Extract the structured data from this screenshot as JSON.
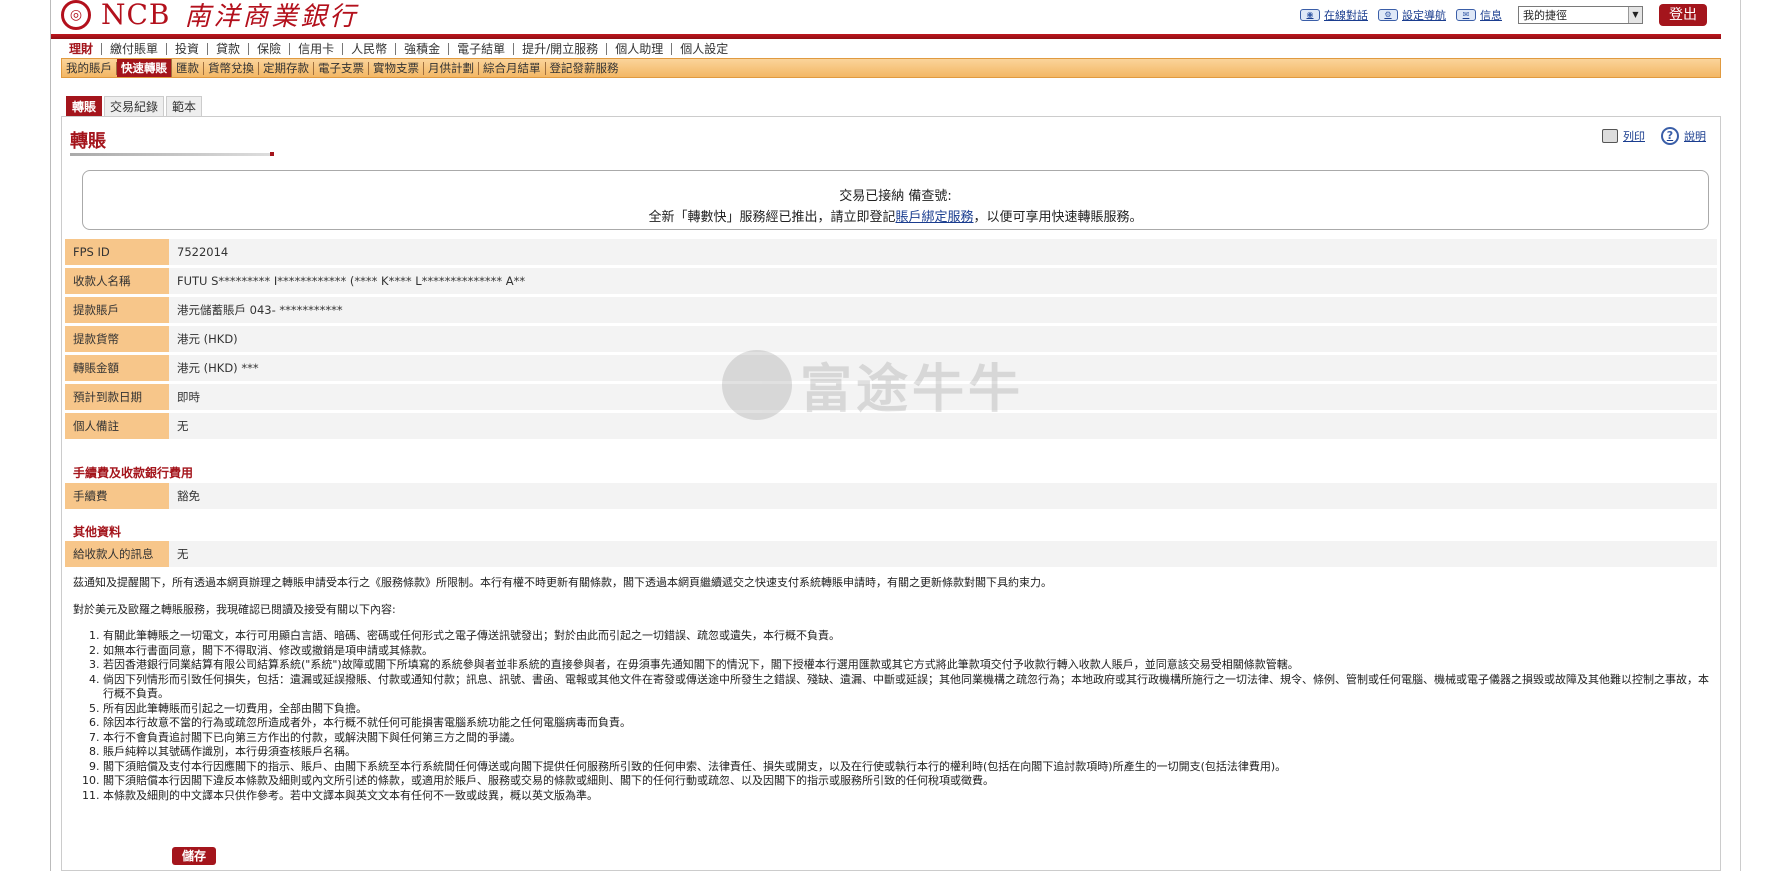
{
  "header": {
    "logo_mark": "NCB",
    "logo_text": "NCB",
    "logo_cn": "南洋商業銀行",
    "tools": [
      {
        "label": "在線對話",
        "icon": "chat-icon"
      },
      {
        "label": "設定導航",
        "icon": "settings-icon"
      },
      {
        "label": "信息",
        "icon": "mail-icon"
      }
    ],
    "quick_select": "我的捷徑",
    "logout_label": "登出"
  },
  "main_nav": [
    {
      "label": "理財",
      "active": true
    },
    {
      "label": "繳付賬單"
    },
    {
      "label": "投資"
    },
    {
      "label": "貸款"
    },
    {
      "label": "保險"
    },
    {
      "label": "信用卡"
    },
    {
      "label": "人民幣"
    },
    {
      "label": "強積金"
    },
    {
      "label": "電子結單"
    },
    {
      "label": "提升/開立服務"
    },
    {
      "label": "個人助理"
    },
    {
      "label": "個人設定"
    }
  ],
  "sub_nav": [
    {
      "label": "我的賬戶"
    },
    {
      "label": "快速轉賬",
      "active": true
    },
    {
      "label": "匯款"
    },
    {
      "label": "貨幣兌換"
    },
    {
      "label": "定期存款"
    },
    {
      "label": "電子支票"
    },
    {
      "label": "實物支票"
    },
    {
      "label": "月供計劃"
    },
    {
      "label": "綜合月結單"
    },
    {
      "label": "登記發薪服務"
    }
  ],
  "tabs": [
    {
      "label": "轉賬",
      "active": true
    },
    {
      "label": "交易紀錄"
    },
    {
      "label": "範本"
    }
  ],
  "page": {
    "title": "轉賬",
    "print_label": "列印",
    "help_label": "說明"
  },
  "notice": {
    "line1": "交易已接納 備查號:",
    "line2_prefix": "全新「轉數快」服務經已推出，請立即登記",
    "line2_link": "賬戶綁定服務",
    "line2_suffix": "，以便可享用快速轉賬服務。"
  },
  "details": [
    {
      "label": "FPS ID",
      "value": "7522014"
    },
    {
      "label": "收款人名稱",
      "value": "FUTU S********* I************ (**** K**** L************** A**"
    },
    {
      "label": "提款賬戶",
      "value": "港元儲蓄賬戶 043-  ***********"
    },
    {
      "label": "提款貨幣",
      "value": "港元 (HKD)"
    },
    {
      "label": "轉賬金額",
      "value": "港元 (HKD)  ***"
    },
    {
      "label": "預計到款日期",
      "value": "即時"
    },
    {
      "label": "個人備註",
      "value": "无"
    }
  ],
  "fees": {
    "section_title": "手續費及收款銀行費用",
    "label": "手續費",
    "value": "豁免"
  },
  "other": {
    "section_title": "其他資料",
    "label": "給收款人的訊息",
    "value": "无"
  },
  "terms": {
    "intro": "茲通知及提醒閣下，所有透過本網頁辦理之轉賬申請受本行之《服務條款》所限制。本行有權不時更新有關條款，閣下透過本網頁繼續遞交之快速支付系統轉賬申請時，有關之更新條款對閣下具約束力。",
    "intro2": "對於美元及歐羅之轉賬服務，我現確認已閱讀及接受有關以下內容:",
    "items": [
      "有關此筆轉賬之一切電文，本行可用顯白言語、暗碼、密碼或任何形式之電子傳送訊號發出；對於由此而引起之一切錯誤、疏忽或遺失，本行概不負責。",
      "如無本行書面同意，閣下不得取消、修改或撤銷是項申請或其條款。",
      "若因香港銀行同業結算有限公司結算系統(\"系統\")故障或閣下所填寫的系統參與者並非系統的直接參與者，在毋須事先通知閣下的情況下，閣下授權本行選用匯款或其它方式將此筆款項交付予收款行轉入收款人賬戶，並同意該交易受相關條款管轄。",
      "倘因下列情形而引致任何損失，包括：遺漏或延誤撥賬、付款或通知付款；訊息、訊號、書函、電報或其他文件在寄發或傳送途中所發生之錯誤、殘缺、遺漏、中斷或延誤；其他同業機構之疏忽行為；本地政府或其行政機構所施行之一切法律、規令、條例、管制或任何電腦、機械或電子儀器之損毀或故障及其他難以控制之事故，本行概不負責。",
      "所有因此筆轉賬而引起之一切費用，全部由閣下負擔。",
      "除因本行故意不當的行為或疏忽所造成者外，本行概不就任何可能損害電腦系統功能之任何電腦病毒而負責。",
      "本行不會負責追討閣下已向第三方作出的付款，或解決閣下與任何第三方之間的爭議。",
      "賬戶純粹以其號碼作識別，本行毋須查核賬戶名稱。",
      "閣下須賠償及支付本行因應閣下的指示、賬戶、由閣下系統至本行系統間任何傳送或向閣下提供任何服務所引致的任何申索、法律責任、損失或開支，以及在行使或執行本行的權利時(包括在向閣下追討款項時)所產生的一切開支(包括法律費用)。",
      "閣下須賠償本行因閣下違反本條款及細則或內文所引述的條款，或適用於賬戶、服務或交易的條款或細則、閣下的任何行動或疏忽、以及因閣下的指示或服務所引致的任何稅項或徵費。",
      "本條款及細則的中文譯本只供作參考。若中文譯本與英文文本有任何不一致或歧異，概以英文版為準。"
    ]
  },
  "save_label": "儲存",
  "watermark": "富途牛牛"
}
